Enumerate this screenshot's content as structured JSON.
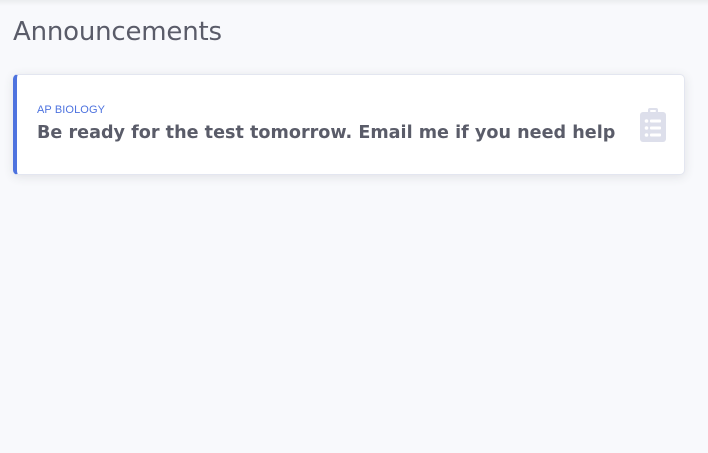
{
  "page": {
    "title": "Announcements"
  },
  "announcements": [
    {
      "course": "AP BIOLOGY",
      "message": "Be ready for the test tomorrow. Email me if you need help",
      "icon": "clipboard-list-icon"
    }
  ],
  "colors": {
    "accent": "#4e73df",
    "text": "#5a5c69",
    "icon": "#dddfeb",
    "background": "#f8f9fc"
  }
}
